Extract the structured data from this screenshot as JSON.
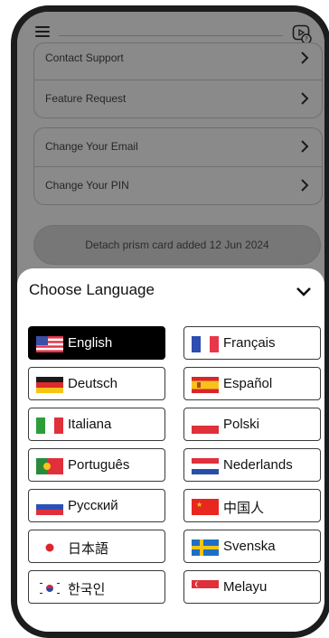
{
  "settings": {
    "rows_group1": [
      "Contact Support",
      "Feature Request"
    ],
    "rows_group2": [
      "Change Your Email",
      "Change Your PIN"
    ],
    "detach_label": "Detach prism card added 12 Jun 2024"
  },
  "sheet": {
    "title": "Choose Language",
    "languages": [
      {
        "label": "English",
        "flag": "us-flag-icon",
        "selected": true
      },
      {
        "label": "Français",
        "flag": "france-flag-icon",
        "selected": false
      },
      {
        "label": "Deutsch",
        "flag": "germany-flag-icon",
        "selected": false
      },
      {
        "label": "Español",
        "flag": "spain-flag-icon",
        "selected": false
      },
      {
        "label": "Italiana",
        "flag": "italy-flag-icon",
        "selected": false
      },
      {
        "label": "Polski",
        "flag": "poland-flag-icon",
        "selected": false
      },
      {
        "label": "Português",
        "flag": "portugal-flag-icon",
        "selected": false
      },
      {
        "label": "Nederlands",
        "flag": "netherlands-flag-icon",
        "selected": false
      },
      {
        "label": "Русский",
        "flag": "russia-flag-icon",
        "selected": false
      },
      {
        "label": "中国人",
        "flag": "china-flag-icon",
        "selected": false
      },
      {
        "label": "日本語",
        "flag": "japan-flag-icon",
        "selected": false
      },
      {
        "label": "Svenska",
        "flag": "sweden-flag-icon",
        "selected": false
      },
      {
        "label": "한국인",
        "flag": "korea-flag-icon",
        "selected": false
      },
      {
        "label": "Melayu",
        "flag": "singapore-flag-icon",
        "selected": false
      }
    ]
  },
  "colors": {
    "overlay": "#8a8a8a",
    "selected_bg": "#000000",
    "border": "#3a3a3a"
  }
}
